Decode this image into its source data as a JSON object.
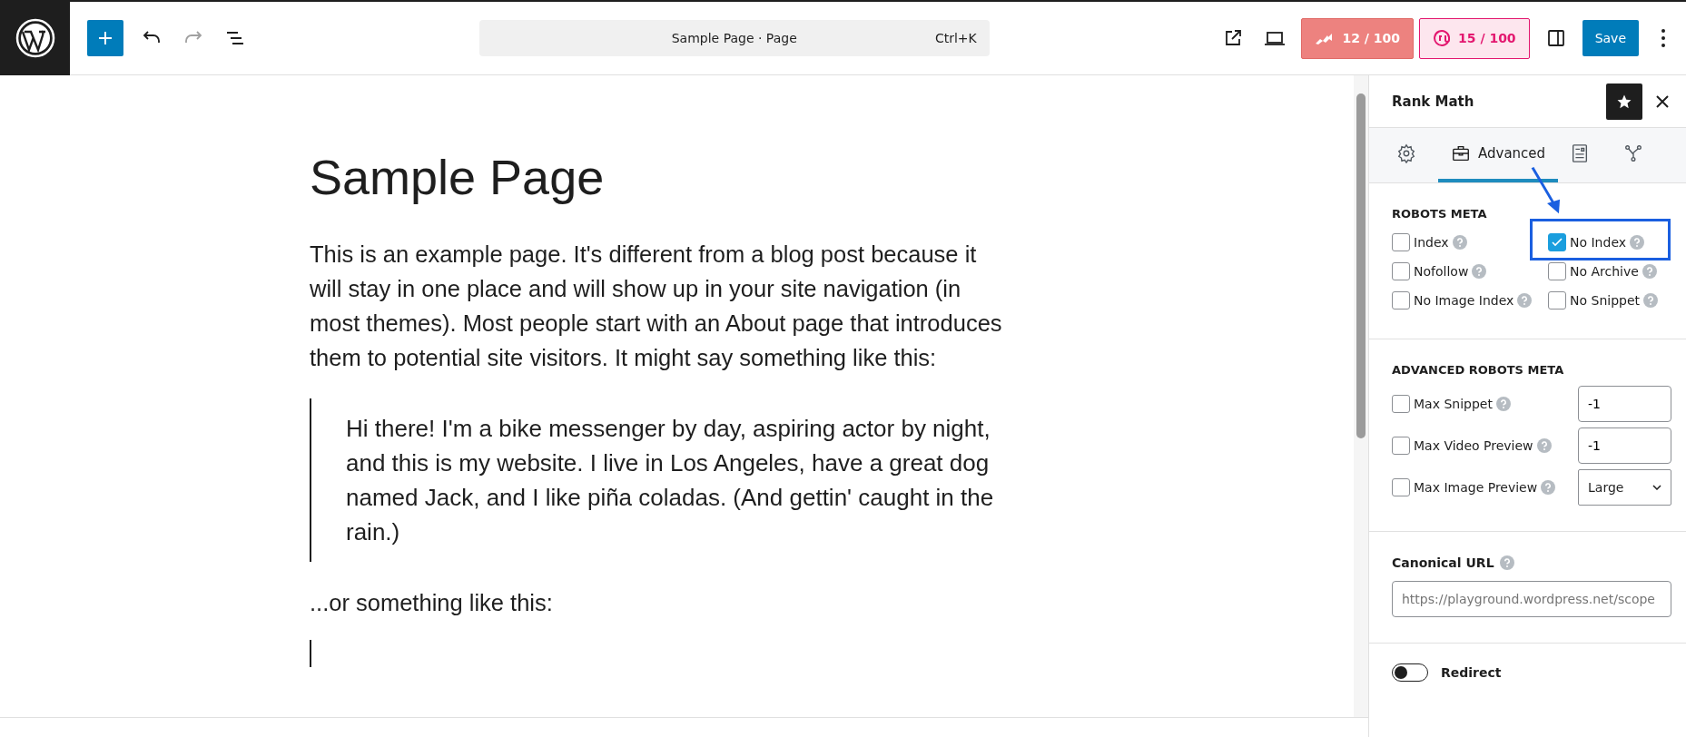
{
  "toolbar": {
    "document_title": "Sample Page · Page",
    "shortcut": "Ctrl+K",
    "scores": [
      {
        "kind": "seo",
        "label": "12 / 100"
      },
      {
        "kind": "content_ai",
        "label": "15 / 100"
      }
    ],
    "save": "Save"
  },
  "editor": {
    "title": "Sample Page",
    "paragraph": "This is an example page. It's different from a blog post because it will stay in one place and will show up in your site navigation (in most themes). Most people start with an About page that introduces them to potential site visitors. It might say something like this:",
    "quote": "Hi there! I'm a bike messenger by day, aspiring actor by night, and this is my website. I live in Los Angeles, have a great dog named Jack, and I like piña coladas. (And gettin' caught in the rain.)",
    "after": "...or something like this:"
  },
  "sidebar": {
    "title": "Rank Math",
    "tabs": [
      {
        "kind": "general",
        "selected": false
      },
      {
        "kind": "advanced",
        "label": "Advanced",
        "selected": true
      },
      {
        "kind": "schema",
        "selected": false
      },
      {
        "kind": "social",
        "selected": false
      }
    ],
    "robots_meta": {
      "heading": "ROBOTS META",
      "options": [
        {
          "label": "Index",
          "checked": false,
          "annotated": false
        },
        {
          "label": "No Index",
          "checked": true,
          "annotated": true
        },
        {
          "label": "Nofollow",
          "checked": false,
          "annotated": false
        },
        {
          "label": "No Archive",
          "checked": false,
          "annotated": false
        },
        {
          "label": "No Image Index",
          "checked": false,
          "annotated": false
        },
        {
          "label": "No Snippet",
          "checked": false,
          "annotated": false
        }
      ]
    },
    "advanced_robots_meta": {
      "heading": "ADVANCED ROBOTS META",
      "rows": [
        {
          "label": "Max Snippet",
          "checked": false,
          "kind": "number",
          "value": "-1"
        },
        {
          "label": "Max Video Preview",
          "checked": false,
          "kind": "number",
          "value": "-1"
        },
        {
          "label": "Max Image Preview",
          "checked": false,
          "kind": "select",
          "value": "Large"
        }
      ]
    },
    "canonical": {
      "label": "Canonical URL",
      "placeholder": "https://playground.wordpress.net/scope"
    },
    "redirect": {
      "label": "Redirect",
      "on": false
    }
  }
}
